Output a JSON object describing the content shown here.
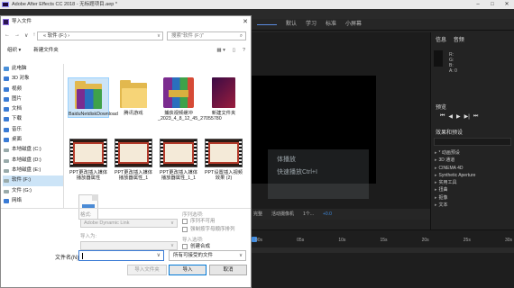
{
  "ae": {
    "title": "Adobe After Effects CC 2018 - 无标题项目.aep *",
    "workspaces": [
      "默认",
      "学习",
      "标准",
      "小屏幕"
    ],
    "watermark_line1": "体播放",
    "watermark_line2": "快速播放Ctrl+I",
    "viewer_toolbar": [
      "完整",
      "活动摄像机",
      "1个...",
      "+0.0"
    ],
    "ruler_ticks": [
      "00s",
      "05s",
      "10s",
      "15s",
      "20s",
      "25s",
      "30s"
    ],
    "right_panels": {
      "info_tabs": [
        "信息",
        "音频"
      ],
      "info_lines": [
        "R:",
        "G:",
        "B:",
        "A: 0"
      ],
      "preview_title": "预览",
      "playback_controls": [
        "⏮",
        "◀",
        "▶",
        "▶|",
        "⏭"
      ],
      "effects_title": "效果和预设",
      "effects_items": [
        "* 动画预设",
        "3D 通道",
        "CINEMA 4D",
        "Synthetic Aperture",
        "实用工具",
        "扭曲",
        "抠像",
        "文本"
      ]
    }
  },
  "dialog": {
    "title": "导入文件",
    "close": "✕",
    "nav_arrows": [
      "←",
      "→",
      "∨",
      "↑"
    ],
    "address": "« 软件 (F:) ›",
    "search_placeholder": "搜索\"软件 (F:)\"",
    "organize": "组织 ▾",
    "new_folder": "新建文件夹",
    "sidebar": [
      {
        "label": "此电脑",
        "kind": "pc"
      },
      {
        "label": "3D 对象",
        "kind": "item"
      },
      {
        "label": "视频",
        "kind": "item"
      },
      {
        "label": "图片",
        "kind": "item"
      },
      {
        "label": "文档",
        "kind": "item"
      },
      {
        "label": "下载",
        "kind": "item"
      },
      {
        "label": "音乐",
        "kind": "item"
      },
      {
        "label": "桌面",
        "kind": "item"
      },
      {
        "label": "本地磁盘 (C:)",
        "kind": "drive"
      },
      {
        "label": "本地磁盘 (D:)",
        "kind": "drive"
      },
      {
        "label": "本地磁盘 (E:)",
        "kind": "drive"
      },
      {
        "label": "软件 (F:)",
        "kind": "drive"
      },
      {
        "label": "文件 (G:)",
        "kind": "drive"
      },
      {
        "label": "网络",
        "kind": "item"
      }
    ],
    "files": [
      {
        "label": "BaiduNetdiskDownload",
        "type": "folder-rar"
      },
      {
        "label": "腾讯游戏",
        "type": "folder"
      },
      {
        "label": "捕获视频缓冲_2023_4_8_12_45_27055780",
        "type": "rar"
      },
      {
        "label": "新建文件夹",
        "type": "premiere"
      },
      {
        "label": "PPT更改插入媒体播放器属性",
        "type": "thumb"
      },
      {
        "label": "PPT更改插入媒体播放器属性_1",
        "type": "thumb"
      },
      {
        "label": "PPT更改插入媒体播放器属性_1_1",
        "type": "thumb"
      },
      {
        "label": "PPT设置插入视频效果 (2)",
        "type": "thumb"
      },
      {
        "label": "",
        "type": "doc"
      }
    ],
    "options": {
      "format_label": "格式:",
      "format_value": "Adobe Dynamic Link",
      "import_as_label": "导入为:",
      "sequence_label": "序列选项:",
      "sequence_check": "序列不可用",
      "force_alpha": "强制按字母顺序排列",
      "import_options_label": "导入选项:",
      "create_comp": "创建合成"
    },
    "filename_label": "文件名(N):",
    "filename_value": "",
    "filetype_value": "所有可接受的文件",
    "import_folder_btn": "导入文件夹",
    "import_btn": "导入",
    "cancel_btn": "取消"
  },
  "colors": {
    "accent": "#3f8be0",
    "selection": "#cce4f7"
  }
}
